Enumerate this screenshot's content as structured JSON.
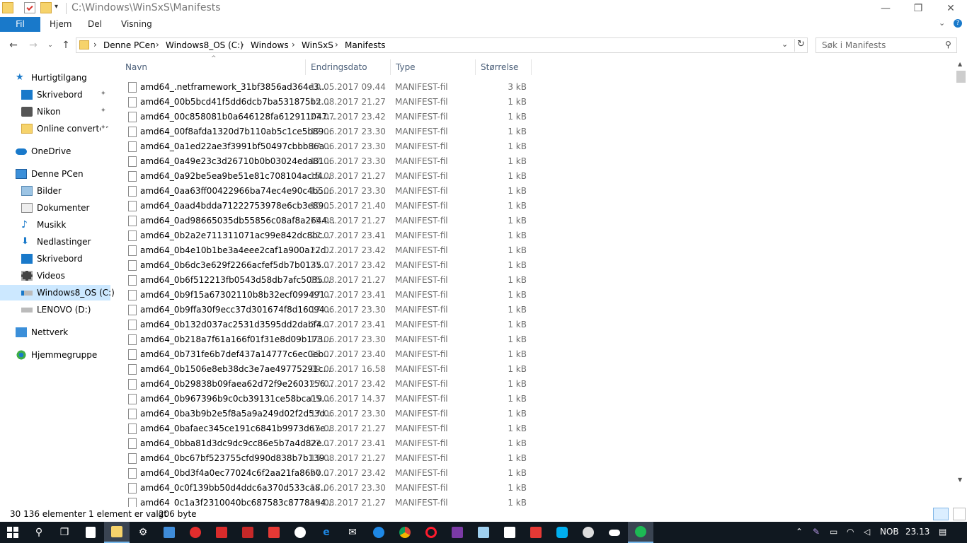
{
  "window": {
    "title": "C:\\Windows\\WinSxS\\Manifests"
  },
  "ribbon": {
    "tabs": [
      "Fil",
      "Hjem",
      "Del",
      "Visning"
    ]
  },
  "address": {
    "crumbs": [
      "Denne PCen",
      "Windows8_OS (C:)",
      "Windows",
      "WinSxS",
      "Manifests"
    ],
    "search_placeholder": "Søk i Manifests"
  },
  "sidebar": {
    "quick": "Hurtigtilgang",
    "quick_items": [
      "Skrivebord",
      "Nikon",
      "Online converter"
    ],
    "onedrive": "OneDrive",
    "pc": "Denne PCen",
    "pc_items": [
      "Bilder",
      "Dokumenter",
      "Musikk",
      "Nedlastinger",
      "Skrivebord",
      "Videos",
      "Windows8_OS (C:)",
      "LENOVO (D:)"
    ],
    "network": "Nettverk",
    "homegroup": "Hjemmegruppe"
  },
  "columns": {
    "name": "Navn",
    "date": "Endringsdato",
    "type": "Type",
    "size": "Størrelse"
  },
  "files": [
    {
      "name": "amd64_.netframework_31bf3856ad364e3...",
      "date": "10.05.2017 09.44",
      "type": "MANIFEST-fil",
      "size": "3 kB"
    },
    {
      "name": "amd64_00b5bcd41f5dd6dcb7ba531875b2...",
      "date": "15.08.2017 21.27",
      "type": "MANIFEST-fil",
      "size": "1 kB"
    },
    {
      "name": "amd64_00c858081b0a646128fa612911047...",
      "date": "27.07.2017 23.42",
      "type": "MANIFEST-fil",
      "size": "1 kB"
    },
    {
      "name": "amd64_00f8afda1320d7b110ab5c1ce5b89...",
      "date": "17.06.2017 23.30",
      "type": "MANIFEST-fil",
      "size": "1 kB"
    },
    {
      "name": "amd64_0a1ed22ae3f3991bf50497cbbb86a...",
      "date": "17.06.2017 23.30",
      "type": "MANIFEST-fil",
      "size": "1 kB"
    },
    {
      "name": "amd64_0a49e23c3d26710b0b03024eda81...",
      "date": "17.06.2017 23.30",
      "type": "MANIFEST-fil",
      "size": "1 kB"
    },
    {
      "name": "amd64_0a92be5ea9be51e81c708104acd4...",
      "date": "15.08.2017 21.27",
      "type": "MANIFEST-fil",
      "size": "1 kB"
    },
    {
      "name": "amd64_0aa63ff00422966ba74ec4e90c4b5...",
      "date": "17.06.2017 23.30",
      "type": "MANIFEST-fil",
      "size": "1 kB"
    },
    {
      "name": "amd64_0aad4bdda71222753978e6cb3e89...",
      "date": "10.05.2017 21.40",
      "type": "MANIFEST-fil",
      "size": "1 kB"
    },
    {
      "name": "amd64_0ad98665035db55856c08af8a2644...",
      "date": "15.08.2017 21.27",
      "type": "MANIFEST-fil",
      "size": "1 kB"
    },
    {
      "name": "amd64_0b2a2e711311071ac99e842dc8bc...",
      "date": "27.07.2017 23.41",
      "type": "MANIFEST-fil",
      "size": "1 kB"
    },
    {
      "name": "amd64_0b4e10b1be3a4eee2caf1a900a12d...",
      "date": "27.07.2017 23.42",
      "type": "MANIFEST-fil",
      "size": "1 kB"
    },
    {
      "name": "amd64_0b6dc3e629f2266acfef5db7b0135...",
      "date": "27.07.2017 23.42",
      "type": "MANIFEST-fil",
      "size": "1 kB"
    },
    {
      "name": "amd64_0b6f512213fb0543d58db7afc5085...",
      "date": "15.08.2017 21.27",
      "type": "MANIFEST-fil",
      "size": "1 kB"
    },
    {
      "name": "amd64_0b9f15a67302110b8b32ecf099491...",
      "date": "27.07.2017 23.41",
      "type": "MANIFEST-fil",
      "size": "1 kB"
    },
    {
      "name": "amd64_0b9ffa30f9ecc37d301674f8d16094...",
      "date": "17.06.2017 23.30",
      "type": "MANIFEST-fil",
      "size": "1 kB"
    },
    {
      "name": "amd64_0b132d037ac2531d3595dd2dabf4...",
      "date": "27.07.2017 23.41",
      "type": "MANIFEST-fil",
      "size": "1 kB"
    },
    {
      "name": "amd64_0b218a7f61a166f01f31e8d09b173...",
      "date": "17.06.2017 23.30",
      "type": "MANIFEST-fil",
      "size": "1 kB"
    },
    {
      "name": "amd64_0b731fe6b7def437a14777c6ec0eb...",
      "date": "27.07.2017 23.40",
      "type": "MANIFEST-fil",
      "size": "1 kB"
    },
    {
      "name": "amd64_0b1506e8eb38dc3e7ae49775291c...",
      "date": "09.06.2017 16.58",
      "type": "MANIFEST-fil",
      "size": "1 kB"
    },
    {
      "name": "amd64_0b29838b09faea62d72f9e2603156...",
      "date": "27.07.2017 23.42",
      "type": "MANIFEST-fil",
      "size": "1 kB"
    },
    {
      "name": "amd64_0b967396b9c0cb39131ce58bca19...",
      "date": "05.06.2017 14.37",
      "type": "MANIFEST-fil",
      "size": "1 kB"
    },
    {
      "name": "amd64_0ba3b9b2e5f8a5a9a249d02f2d53d...",
      "date": "17.06.2017 23.30",
      "type": "MANIFEST-fil",
      "size": "1 kB"
    },
    {
      "name": "amd64_0bafaec345ce191c6841b9973d67e...",
      "date": "15.08.2017 21.27",
      "type": "MANIFEST-fil",
      "size": "1 kB"
    },
    {
      "name": "amd64_0bba81d3dc9dc9cc86e5b7a4d82e...",
      "date": "27.07.2017 23.41",
      "type": "MANIFEST-fil",
      "size": "1 kB"
    },
    {
      "name": "amd64_0bc67bf523755cfd990d838b7b139...",
      "date": "15.08.2017 21.27",
      "type": "MANIFEST-fil",
      "size": "1 kB"
    },
    {
      "name": "amd64_0bd3f4a0ec77024c6f2aa21fa86b0...",
      "date": "27.07.2017 23.42",
      "type": "MANIFEST-fil",
      "size": "1 kB"
    },
    {
      "name": "amd64_0c0f139bb50d4ddc6a370d533ca8...",
      "date": "17.06.2017 23.30",
      "type": "MANIFEST-fil",
      "size": "1 kB"
    },
    {
      "name": "amd64_0c1a3f2310040bc687583c8778a94...",
      "date": "15.08.2017 21.27",
      "type": "MANIFEST-fil",
      "size": "1 kB"
    }
  ],
  "status": {
    "count": "30 136 elementer",
    "selected": "1 element er valgt",
    "size": "206 byte"
  },
  "tray": {
    "lang": "NOB",
    "time": "23.13"
  }
}
